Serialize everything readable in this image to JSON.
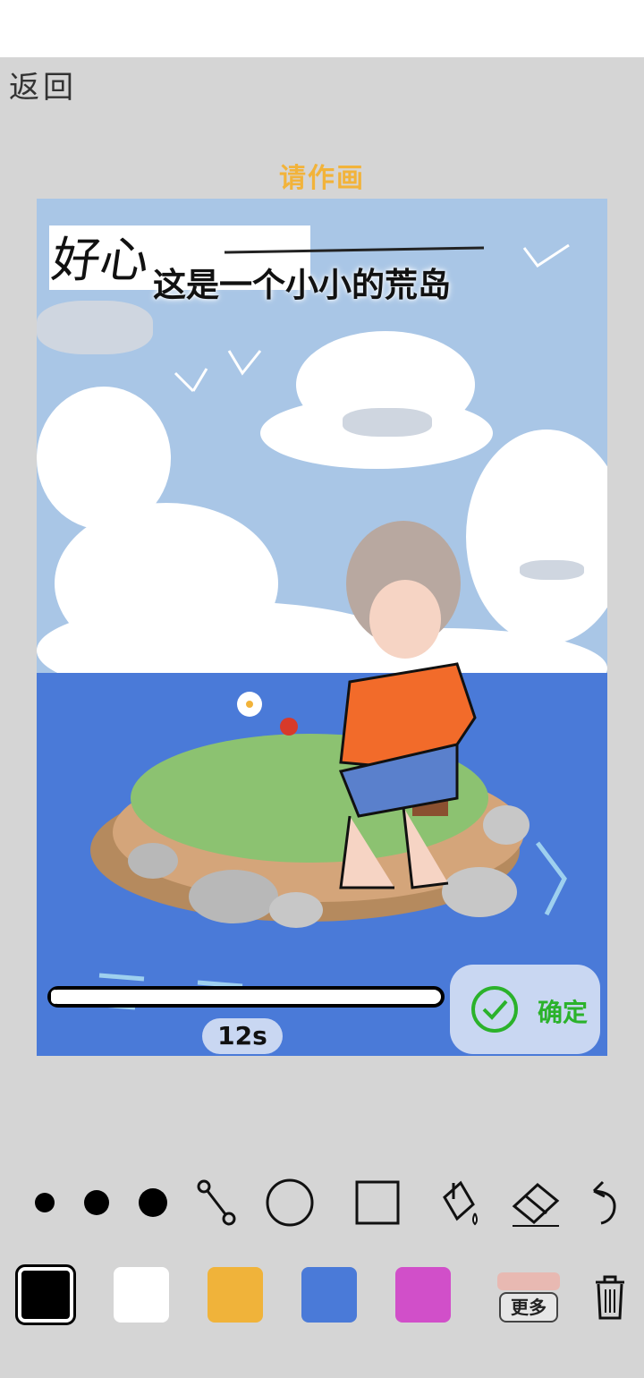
{
  "header": {
    "back_label": "返回"
  },
  "prompt": {
    "label": "请作画"
  },
  "canvas": {
    "handwriting": "好心",
    "title_text": "这是一个小小的荒岛"
  },
  "timer": {
    "progress": 0.02,
    "label": "12s"
  },
  "confirm": {
    "label": "确定",
    "color": "#2bb22b"
  },
  "tools": {
    "brush_sizes": [
      "brush-small",
      "brush-medium",
      "brush-large"
    ],
    "items": [
      "line-tool",
      "circle-tool",
      "rectangle-tool",
      "fill-tool",
      "eraser-tool",
      "undo"
    ]
  },
  "palette": {
    "colors": [
      "#000000",
      "#ffffff",
      "#f0b33a",
      "#4a7ad8",
      "#d14fc9"
    ],
    "selected": "#000000",
    "more_label": "更多",
    "more_swatch": "#e8b9b2"
  }
}
